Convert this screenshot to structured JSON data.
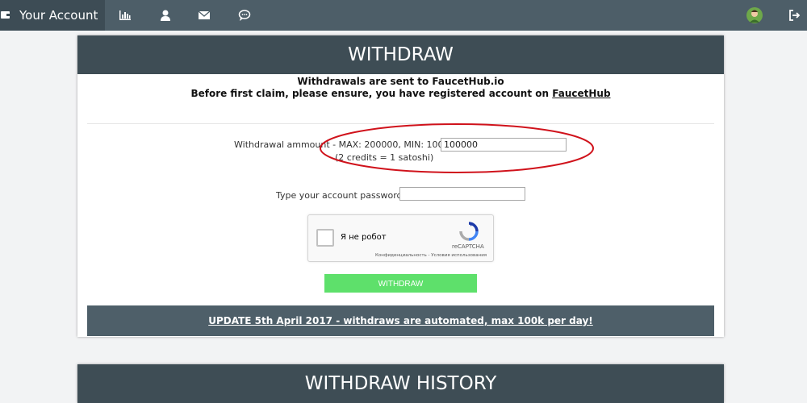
{
  "navbar": {
    "brand_label": "Your Account",
    "icons": [
      "stats-icon",
      "user-icon",
      "mail-icon",
      "chat-icon",
      "avatar",
      "logout-icon"
    ]
  },
  "withdraw_panel": {
    "title": "WITHDRAW",
    "info_line1": "Withdrawals are sent to FaucetHub.io",
    "info_line2_prefix": "Before first claim, please ensure, you have registered account on ",
    "info_line2_link": "FaucetHub",
    "amount_label": "Withdrawal ammount - MAX: 200000, MIN: 100000",
    "amount_value": "100000",
    "credits_note": "(2 credits = 1 satoshi)",
    "password_label": "Type your account password:",
    "password_value": "",
    "captcha": {
      "label": "Я не робот",
      "brand": "reCAPTCHA",
      "legal": "Конфиденциальность - Условия использования"
    },
    "withdraw_button": "WITHDRAW",
    "update_notice": "UPDATE 5th April 2017 - withdraws are automated, max 100k per day!"
  },
  "history_panel": {
    "title": "WITHDRAW HISTORY"
  },
  "colors": {
    "navbar": "#4d5e68",
    "panel_header": "#3e4d55",
    "button": "#5ee06b",
    "highlight_ellipse": "#d0121b"
  }
}
